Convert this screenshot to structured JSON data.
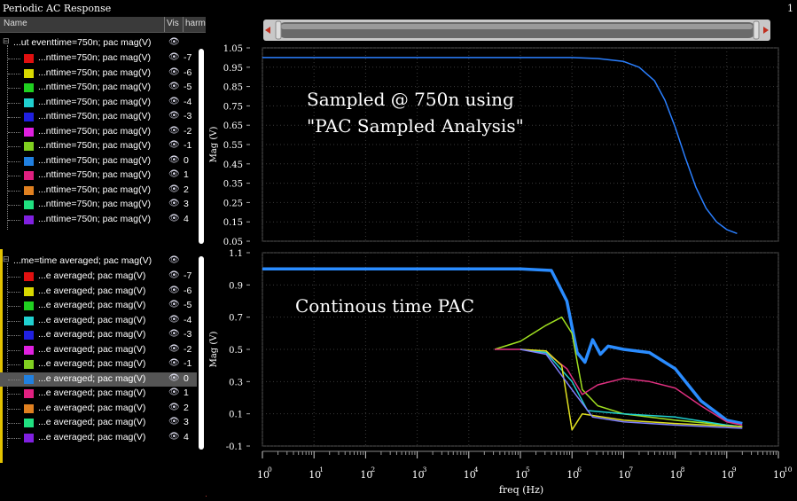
{
  "window": {
    "title": "Periodic AC Response",
    "number": "1"
  },
  "tree": {
    "columns": [
      "Name",
      "Vis",
      "harm"
    ],
    "group1": {
      "label": "...ut eventtime=750n; pac mag(V)",
      "rows": [
        {
          "name": "...nttime=750n; pac mag(V)",
          "harm": "-7",
          "color": "#e01010"
        },
        {
          "name": "...nttime=750n; pac mag(V)",
          "harm": "-6",
          "color": "#d8d800"
        },
        {
          "name": "...nttime=750n; pac mag(V)",
          "harm": "-5",
          "color": "#20d020"
        },
        {
          "name": "...nttime=750n; pac mag(V)",
          "harm": "-4",
          "color": "#20d0d0"
        },
        {
          "name": "...nttime=750n; pac mag(V)",
          "harm": "-3",
          "color": "#2020e0"
        },
        {
          "name": "...nttime=750n; pac mag(V)",
          "harm": "-2",
          "color": "#e020e0"
        },
        {
          "name": "...nttime=750n; pac mag(V)",
          "harm": "-1",
          "color": "#80d020"
        },
        {
          "name": "...nttime=750n; pac mag(V)",
          "harm": "0",
          "color": "#2080e0"
        },
        {
          "name": "...nttime=750n; pac mag(V)",
          "harm": "1",
          "color": "#e02080"
        },
        {
          "name": "...nttime=750n; pac mag(V)",
          "harm": "2",
          "color": "#e08020"
        },
        {
          "name": "...nttime=750n; pac mag(V)",
          "harm": "3",
          "color": "#20e080"
        },
        {
          "name": "...nttime=750n; pac mag(V)",
          "harm": "4",
          "color": "#8020e0"
        }
      ]
    },
    "group2": {
      "label": "...me=time averaged; pac mag(V)",
      "rows": [
        {
          "name": "...e averaged; pac mag(V)",
          "harm": "-7",
          "color": "#e01010"
        },
        {
          "name": "...e averaged; pac mag(V)",
          "harm": "-6",
          "color": "#d8d800"
        },
        {
          "name": "...e averaged; pac mag(V)",
          "harm": "-5",
          "color": "#20d020"
        },
        {
          "name": "...e averaged; pac mag(V)",
          "harm": "-4",
          "color": "#20d0d0"
        },
        {
          "name": "...e averaged; pac mag(V)",
          "harm": "-3",
          "color": "#2020e0"
        },
        {
          "name": "...e averaged; pac mag(V)",
          "harm": "-2",
          "color": "#e020e0"
        },
        {
          "name": "...e averaged; pac mag(V)",
          "harm": "-1",
          "color": "#80d020"
        },
        {
          "name": "...e averaged; pac mag(V)",
          "harm": "0",
          "color": "#2080e0",
          "selected": true
        },
        {
          "name": "...e averaged; pac mag(V)",
          "harm": "1",
          "color": "#e02080"
        },
        {
          "name": "...e averaged; pac mag(V)",
          "harm": "2",
          "color": "#e08020"
        },
        {
          "name": "...e averaged; pac mag(V)",
          "harm": "3",
          "color": "#20e080"
        },
        {
          "name": "...e averaged; pac mag(V)",
          "harm": "4",
          "color": "#8020e0"
        }
      ]
    }
  },
  "chart_data": [
    {
      "type": "line",
      "ylabel": "Mag (V)",
      "ylim": [
        0.05,
        1.05
      ],
      "yticks": [
        "1.05",
        "0.95",
        "0.85",
        "0.75",
        "0.65",
        "0.55",
        "0.45",
        "0.35",
        "0.25",
        "0.15",
        "0.05"
      ],
      "annotation": [
        "Sampled @ 750n using",
        "\"PAC Sampled Analysis\""
      ],
      "x_log10": [
        0,
        1,
        2,
        3,
        4,
        5,
        5.5,
        6,
        6.5,
        7,
        7.3,
        7.6,
        7.8,
        8.0,
        8.2,
        8.4,
        8.6,
        8.8,
        9.0,
        9.2
      ],
      "series": [
        {
          "color": "#2a7fff",
          "values": [
            1.0,
            1.0,
            1.0,
            1.0,
            1.0,
            1.0,
            1.0,
            1.0,
            0.995,
            0.98,
            0.95,
            0.88,
            0.78,
            0.64,
            0.48,
            0.33,
            0.22,
            0.15,
            0.11,
            0.09
          ]
        }
      ]
    },
    {
      "type": "line",
      "xlabel": "freq (Hz)",
      "ylabel": "Mag (V)",
      "ylim": [
        -0.1,
        1.1
      ],
      "yticks": [
        "1.1",
        "0.9",
        "0.7",
        "0.5",
        "0.3",
        "0.1",
        "-0.1"
      ],
      "xticks_exp": [
        "0",
        "1",
        "2",
        "3",
        "4",
        "5",
        "6",
        "7",
        "8",
        "9",
        "10"
      ],
      "annotation": [
        "Continous time PAC"
      ],
      "series": [
        {
          "color": "#2a8cff",
          "x_log10": [
            0,
            3,
            5,
            5.6,
            5.9,
            6.1,
            6.25,
            6.4,
            6.55,
            6.7,
            7,
            7.5,
            8,
            8.5,
            9,
            9.3
          ],
          "values": [
            1.0,
            1.0,
            1.0,
            0.99,
            0.8,
            0.48,
            0.42,
            0.56,
            0.47,
            0.52,
            0.5,
            0.48,
            0.38,
            0.18,
            0.06,
            0.04
          ]
        },
        {
          "color": "#a0e020",
          "x_log10": [
            4.5,
            5,
            5.5,
            5.8,
            6.0,
            6.2,
            6.5,
            7,
            8,
            9,
            9.3
          ],
          "values": [
            0.5,
            0.55,
            0.65,
            0.7,
            0.6,
            0.25,
            0.15,
            0.1,
            0.06,
            0.03,
            0.02
          ]
        },
        {
          "color": "#e03080",
          "x_log10": [
            4.5,
            5,
            5.5,
            5.9,
            6.2,
            6.5,
            7,
            7.5,
            8,
            8.5,
            9,
            9.3
          ],
          "values": [
            0.5,
            0.5,
            0.48,
            0.38,
            0.22,
            0.28,
            0.32,
            0.3,
            0.26,
            0.15,
            0.05,
            0.03
          ]
        },
        {
          "color": "#20d0d0",
          "x_log10": [
            5,
            5.5,
            6.0,
            6.3,
            7,
            8,
            9,
            9.3
          ],
          "values": [
            0.5,
            0.48,
            0.3,
            0.12,
            0.1,
            0.08,
            0.03,
            0.02
          ]
        },
        {
          "color": "#e0e020",
          "x_log10": [
            5,
            5.5,
            5.8,
            6.0,
            6.2,
            7,
            8,
            9.3
          ],
          "values": [
            0.5,
            0.49,
            0.4,
            0.0,
            0.1,
            0.06,
            0.04,
            0.02
          ]
        },
        {
          "color": "#8080ff",
          "x_log10": [
            5,
            5.5,
            6.0,
            6.4,
            7,
            8,
            9.3
          ],
          "values": [
            0.5,
            0.47,
            0.25,
            0.08,
            0.05,
            0.03,
            0.01
          ]
        }
      ]
    }
  ]
}
